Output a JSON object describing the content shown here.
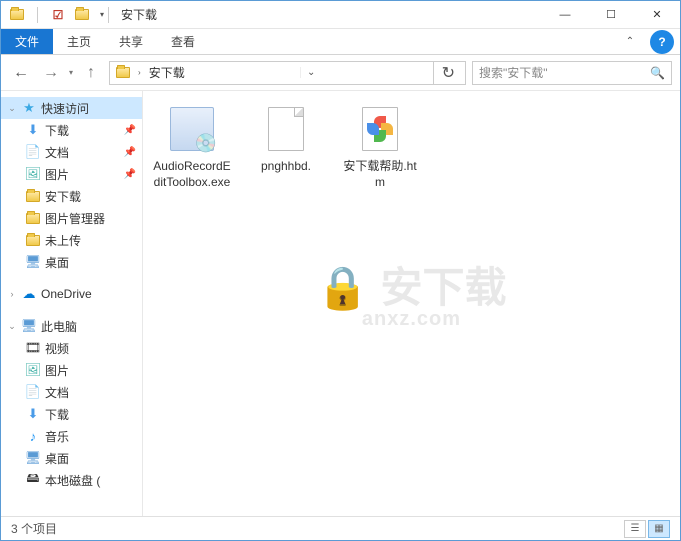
{
  "window": {
    "title": "安下载"
  },
  "ribbon": {
    "file": "文件",
    "tabs": [
      "主页",
      "共享",
      "查看"
    ]
  },
  "address": {
    "path": "安下载",
    "search_placeholder": "搜索\"安下载\""
  },
  "sidebar": {
    "quick_access": "快速访问",
    "items_pinned": [
      {
        "label": "下载",
        "icon": "download"
      },
      {
        "label": "文档",
        "icon": "document"
      },
      {
        "label": "图片",
        "icon": "picture"
      },
      {
        "label": "安下载",
        "icon": "folder"
      },
      {
        "label": "图片管理器",
        "icon": "folder"
      },
      {
        "label": "未上传",
        "icon": "folder"
      }
    ],
    "desktop": "桌面",
    "onedrive": "OneDrive",
    "this_pc": "此电脑",
    "pc_items": [
      {
        "label": "视频",
        "icon": "video"
      },
      {
        "label": "图片",
        "icon": "picture"
      },
      {
        "label": "文档",
        "icon": "document"
      },
      {
        "label": "下载",
        "icon": "download"
      },
      {
        "label": "音乐",
        "icon": "music"
      },
      {
        "label": "桌面",
        "icon": "desktop"
      },
      {
        "label": "本地磁盘 (",
        "icon": "disk"
      }
    ]
  },
  "files": [
    {
      "name": "AudioRecordEditToolbox.exe",
      "type": "exe"
    },
    {
      "name": "pnghhbd.",
      "type": "blank"
    },
    {
      "name": "安下载帮助.htm",
      "type": "htm"
    }
  ],
  "status": {
    "count": "3 个项目"
  },
  "watermark": {
    "main": "安下载",
    "sub": "anxz.com"
  }
}
